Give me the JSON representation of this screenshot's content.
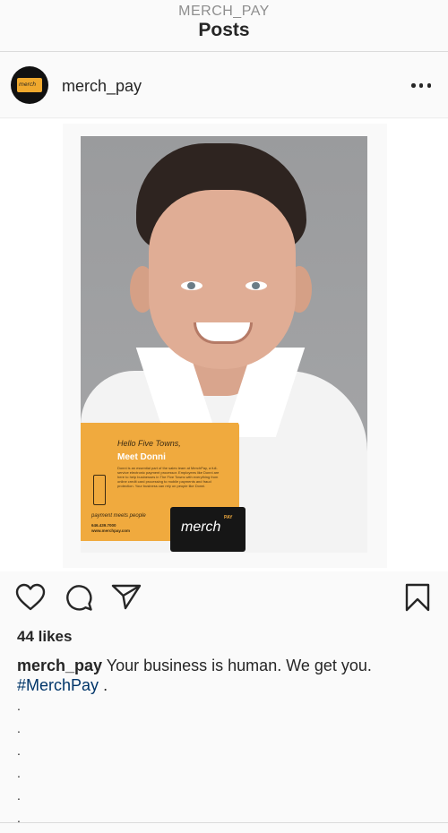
{
  "header": {
    "account_label": "MERCH_PAY",
    "title": "Posts"
  },
  "post": {
    "username": "merch_pay",
    "avatar_text": "merch",
    "more_icon": "more-horizontal-icon",
    "image": {
      "greeting": "Hello Five Towns,",
      "headline": "Meet Donni",
      "body": "Donni is an essential part of the sales team at MerchPay, a full-service electronic payment processor. Employees like Donni are here to help businesses in The Five Towns with everything from online credit card processing to mobile payments and fraud protection. Your business can rely on people like Donni.",
      "tagline": "payment meets people",
      "phone": "646.439.7000",
      "site": "www.merchpay.com",
      "logo_text": "merch",
      "logo_sup": "PAY"
    },
    "actions": {
      "like": "heart-icon",
      "comment": "comment-icon",
      "share": "send-icon",
      "save": "bookmark-icon"
    },
    "likes": "44 likes",
    "caption": {
      "username": "merch_pay",
      "text": "Your business is human. We get you.",
      "hashtag": "#MerchPay",
      "suffix": "."
    },
    "dots": [
      ".",
      ".",
      ".",
      ".",
      ".",
      "."
    ]
  },
  "colors": {
    "brand_orange": "#f0aa3e",
    "hashtag": "#003569",
    "text": "#262626",
    "muted": "#8e8e8e"
  }
}
